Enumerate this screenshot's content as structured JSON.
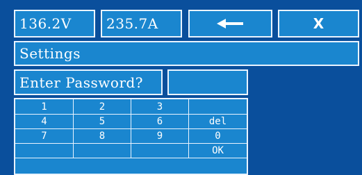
{
  "header": {
    "voltage": "136.2V",
    "current": "235.7A",
    "back_icon": "arrow-left-icon",
    "close_label": "X"
  },
  "title": "Settings",
  "password": {
    "prompt": "Enter Password?",
    "value": ""
  },
  "keypad": {
    "rows": [
      [
        "1",
        "2",
        "3",
        ""
      ],
      [
        "4",
        "5",
        "6",
        "del"
      ],
      [
        "7",
        "8",
        "9",
        "0"
      ],
      [
        "",
        "",
        "",
        "OK"
      ]
    ]
  },
  "colors": {
    "background": "#0a4f9c",
    "panel": "#1a86cf",
    "border": "#eaf4ff"
  }
}
